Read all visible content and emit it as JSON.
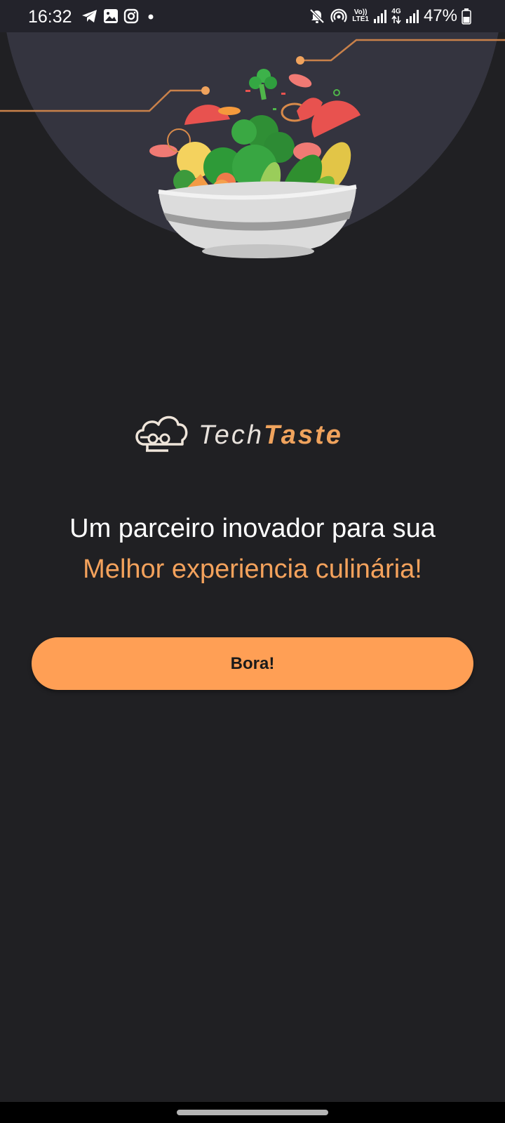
{
  "status_bar": {
    "time": "16:32",
    "battery": "47%",
    "left_icons": [
      "telegram-icon",
      "gallery-icon",
      "instagram-icon",
      "notification-dot-icon"
    ],
    "right_icons": [
      "mute-icon",
      "hotspot-icon",
      "volte-icon",
      "signal-icon",
      "4g-icon",
      "signal-icon",
      "battery-icon"
    ],
    "volte_label_top": "Vo))",
    "volte_label_bottom": "LTE1",
    "network_label": "4G"
  },
  "logo": {
    "part_1": "Tech",
    "part_2": "Taste"
  },
  "tagline": {
    "line_1": "Um parceiro inovador para sua",
    "line_2": "Melhor experiencia culinária!"
  },
  "cta": {
    "label": "Bora!"
  },
  "colors": {
    "background": "#202023",
    "hero": "#34343f",
    "accent": "#ff9f55",
    "accent_text": "#f4a25c"
  }
}
